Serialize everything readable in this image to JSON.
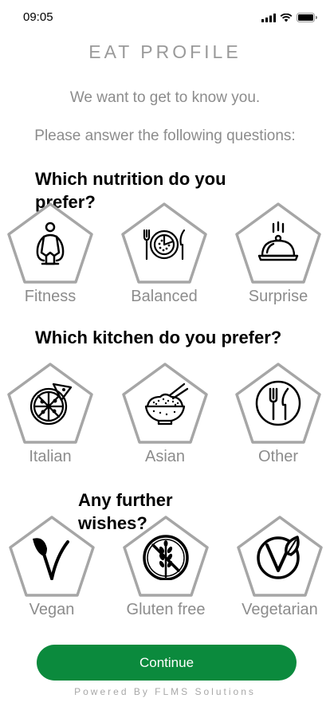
{
  "status_bar": {
    "time": "09:05"
  },
  "header": {
    "title": "EAT PROFILE"
  },
  "intro": {
    "line1": "We want to get to know you.",
    "line2": "Please answer the following questions:"
  },
  "questions": [
    {
      "text": "Which nutrition do you prefer?",
      "options": [
        {
          "label": "Fitness",
          "icon": "fitness-person-icon"
        },
        {
          "label": "Balanced",
          "icon": "plate-cutlery-icon"
        },
        {
          "label": "Surprise",
          "icon": "cloche-icon"
        }
      ]
    },
    {
      "text": "Which kitchen do you prefer?",
      "options": [
        {
          "label": "Italian",
          "icon": "pizza-icon"
        },
        {
          "label": "Asian",
          "icon": "rice-bowl-chopsticks-icon"
        },
        {
          "label": "Other",
          "icon": "cutlery-plate-icon"
        }
      ]
    },
    {
      "text": "Any further wishes?",
      "options": [
        {
          "label": "Vegan",
          "icon": "vegan-leaf-icon"
        },
        {
          "label": "Gluten free",
          "icon": "gluten-free-icon"
        },
        {
          "label": "Vegetarian",
          "icon": "vegetarian-icon"
        }
      ]
    }
  ],
  "actions": {
    "continue_label": "Continue"
  },
  "footer": {
    "text": "Powered By FLMS Solutions"
  },
  "colors": {
    "primary": "#0b8a3d",
    "outline": "#a6a6a6",
    "muted_text": "#8c8c8c"
  }
}
